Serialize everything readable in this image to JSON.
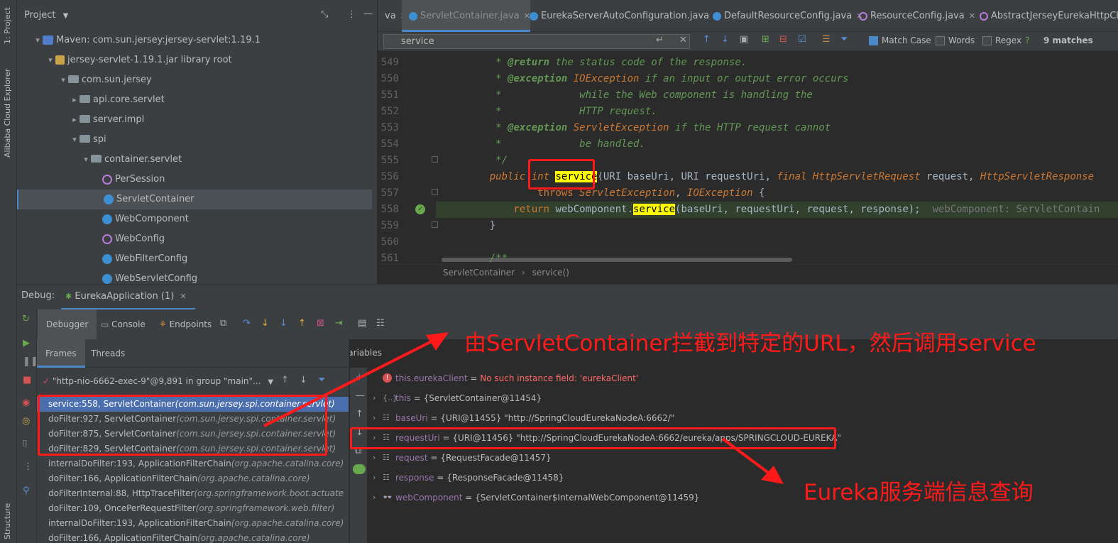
{
  "left_strip": {
    "project_label": "1: Project",
    "cloud_label": "Alibaba Cloud Explorer",
    "structure_label": "Structure"
  },
  "project": {
    "title": "Project",
    "tree": [
      {
        "label": "Maven: com.sun.jersey:jersey-servlet:1.19.1",
        "icon": "maven-icon",
        "arrow": "▾",
        "indent": 22
      },
      {
        "label": "jersey-servlet-1.19.1.jar library root",
        "icon": "jar-icon",
        "arrow": "▾",
        "indent": 40
      },
      {
        "label": "com.sun.jersey",
        "icon": "folder-icon",
        "arrow": "▾",
        "indent": 58
      },
      {
        "label": "api.core.servlet",
        "icon": "folder-icon",
        "arrow": "▸",
        "indent": 74
      },
      {
        "label": "server.impl",
        "icon": "folder-icon",
        "arrow": "▸",
        "indent": 74
      },
      {
        "label": "spi",
        "icon": "folder-icon",
        "arrow": "▾",
        "indent": 74
      },
      {
        "label": "container.servlet",
        "icon": "folder-icon",
        "arrow": "▾",
        "indent": 90
      },
      {
        "label": "PerSession",
        "icon": "annotation-icon",
        "arrow": "",
        "indent": 106
      },
      {
        "label": "ServletContainer",
        "icon": "class-icon",
        "arrow": "",
        "indent": 106,
        "selected": true
      },
      {
        "label": "WebComponent",
        "icon": "class-icon",
        "arrow": "",
        "indent": 106
      },
      {
        "label": "WebConfig",
        "icon": "interface-icon",
        "arrow": "",
        "indent": 106
      },
      {
        "label": "WebFilterConfig",
        "icon": "class-icon",
        "arrow": "",
        "indent": 106
      },
      {
        "label": "WebServletConfig",
        "icon": "class-icon",
        "arrow": "",
        "indent": 106
      }
    ]
  },
  "editor": {
    "tabs": [
      {
        "label": "va",
        "icon": ""
      },
      {
        "label": "ServletContainer.java",
        "icon": "class-icon",
        "active": true
      },
      {
        "label": "EurekaServerAutoConfiguration.java",
        "icon": "class-icon"
      },
      {
        "label": "DefaultResourceConfig.java",
        "icon": "class-icon"
      },
      {
        "label": "ResourceConfig.java",
        "icon": "interface-icon"
      },
      {
        "label": "AbstractJerseyEurekaHttpClier",
        "icon": "interface-icon"
      }
    ],
    "search": {
      "value": "service",
      "match_case": "Match Case",
      "words": "Words",
      "regex": "Regex",
      "matches": "9 matches",
      "help": "?"
    },
    "breadcrumb": {
      "cls": "ServletContainer",
      "sep": "›",
      "method": "service()"
    }
  },
  "code_lines": [
    {
      "num": "549",
      "parts": [
        [
          "cm",
          "     * "
        ],
        [
          "tag",
          "@return"
        ],
        [
          "cm",
          " the status code of the response."
        ]
      ]
    },
    {
      "num": "550",
      "parts": [
        [
          "cm",
          "     * "
        ],
        [
          "tag",
          "@exception"
        ],
        [
          "cm",
          " "
        ],
        [
          "kwitalic",
          "IOException"
        ],
        [
          "cm",
          " if an input or output error occurs"
        ]
      ]
    },
    {
      "num": "551",
      "parts": [
        [
          "cm",
          "     *             while the Web component is handling the"
        ]
      ]
    },
    {
      "num": "552",
      "parts": [
        [
          "cm",
          "     *             HTTP request."
        ]
      ]
    },
    {
      "num": "553",
      "parts": [
        [
          "cm",
          "     * "
        ],
        [
          "tag",
          "@exception"
        ],
        [
          "cm",
          " "
        ],
        [
          "kwitalic",
          "ServletException"
        ],
        [
          "cm",
          " if the HTTP request cannot"
        ]
      ]
    },
    {
      "num": "554",
      "parts": [
        [
          "cm",
          "     *             be handled."
        ]
      ]
    },
    {
      "num": "555",
      "parts": [
        [
          "cm",
          "     */"
        ]
      ]
    },
    {
      "num": "556",
      "parts": [
        [
          "kw",
          "    public int "
        ],
        [
          "hl",
          "service"
        ],
        [
          "pa",
          "(URI baseUri, URI requestUri, "
        ],
        [
          "kw",
          "final "
        ],
        [
          "kw",
          "HttpServletRequest"
        ],
        [
          "pa",
          " request, "
        ],
        [
          "kw",
          "HttpServletResponse"
        ]
      ]
    },
    {
      "num": "557",
      "parts": [
        [
          "pa",
          "            "
        ],
        [
          "kwn",
          "throws "
        ],
        [
          "kw",
          "ServletException"
        ],
        [
          "pa",
          ", "
        ],
        [
          "kw",
          "IOException"
        ],
        [
          "pa",
          " {"
        ]
      ]
    },
    {
      "num": "558",
      "parts": [
        [
          "kwn",
          "        return "
        ],
        [
          "pa",
          "webComponent."
        ],
        [
          "hl",
          "service"
        ],
        [
          "pa",
          "(baseUri, requestUri, request, response);"
        ],
        [
          "inl",
          "  webComponent: ServletContain"
        ]
      ],
      "current": true
    },
    {
      "num": "559",
      "parts": [
        [
          "pa",
          "    }"
        ]
      ]
    },
    {
      "num": "560",
      "parts": [
        [
          "pa",
          ""
        ]
      ]
    },
    {
      "num": "561",
      "parts": [
        [
          "cm",
          "    /**"
        ]
      ]
    }
  ],
  "debug": {
    "label": "Debug:",
    "session_tab": "EurekaApplication (1)",
    "tabs": {
      "debugger": "Debugger",
      "console": "Console",
      "endpoints": "Endpoints"
    },
    "frames_tab": "Frames",
    "threads_tab": "Threads",
    "variables_tab": "Variables",
    "thread_selector": "\"http-nio-6662-exec-9\"@9,891 in group \"main\"...",
    "frames": [
      {
        "method": "service:558, ServletContainer",
        "pkg": "(com.sun.jersey.spi.container.servlet)",
        "selected": true
      },
      {
        "method": "doFilter:927, ServletContainer",
        "pkg": "(com.sun.jersey.spi.container.servlet)"
      },
      {
        "method": "doFilter:875, ServletContainer",
        "pkg": "(com.sun.jersey.spi.container.servlet)"
      },
      {
        "method": "doFilter:829, ServletContainer",
        "pkg": "(com.sun.jersey.spi.container.servlet)"
      },
      {
        "method": "internalDoFilter:193, ApplicationFilterChain",
        "pkg": "(org.apache.catalina.core)"
      },
      {
        "method": "doFilter:166, ApplicationFilterChain",
        "pkg": "(org.apache.catalina.core)"
      },
      {
        "method": "doFilterInternal:88, HttpTraceFilter",
        "pkg": "(org.springframework.boot.actuate"
      },
      {
        "method": "doFilter:109, OncePerRequestFilter",
        "pkg": "(org.springframework.web.filter)"
      },
      {
        "method": "internalDoFilter:193, ApplicationFilterChain",
        "pkg": "(org.apache.catalina.core)"
      },
      {
        "method": "doFilter:166, ApplicationFilterChain",
        "pkg": "(org.apache.catalina.core)"
      }
    ],
    "variables": [
      {
        "name": "this.eurekaClient",
        "eq": " = ",
        "value": "No such instance field: 'eurekaClient'",
        "error": true,
        "icon": "error-icon",
        "expand": ""
      },
      {
        "name": "this",
        "eq": " = ",
        "value": "{ServletContainer@11454}",
        "icon": "object-icon",
        "expand": "›"
      },
      {
        "name": "baseUri",
        "eq": " = ",
        "value": "{URI@11455} \"http://SpringCloudEurekaNodeA:6662/\"",
        "icon": "field-icon",
        "expand": "›"
      },
      {
        "name": "requestUri",
        "eq": " = ",
        "value": "{URI@11456} \"http://SpringCloudEurekaNodeA:6662/eureka/apps/SPRINGCLOUD-EUREKA\"",
        "icon": "field-icon",
        "expand": "›"
      },
      {
        "name": "request",
        "eq": " = ",
        "value": "{RequestFacade@11457}",
        "icon": "field-icon",
        "expand": "›"
      },
      {
        "name": "response",
        "eq": " = ",
        "value": "{ResponseFacade@11458}",
        "icon": "field-icon",
        "expand": "›"
      },
      {
        "name": "webComponent",
        "eq": " = ",
        "value": "{ServletContainer$InternalWebComponent@11459}",
        "icon": "watch-icon",
        "expand": "›"
      }
    ]
  },
  "annotations": {
    "top": "由ServletContainer拦截到特定的URL，然后调用service",
    "bottom": "Eureka服务端信息查询"
  },
  "colors": {
    "annotation": "#ff1a1a",
    "selection": "#4b6eaf",
    "highlight": "#ffff00"
  }
}
